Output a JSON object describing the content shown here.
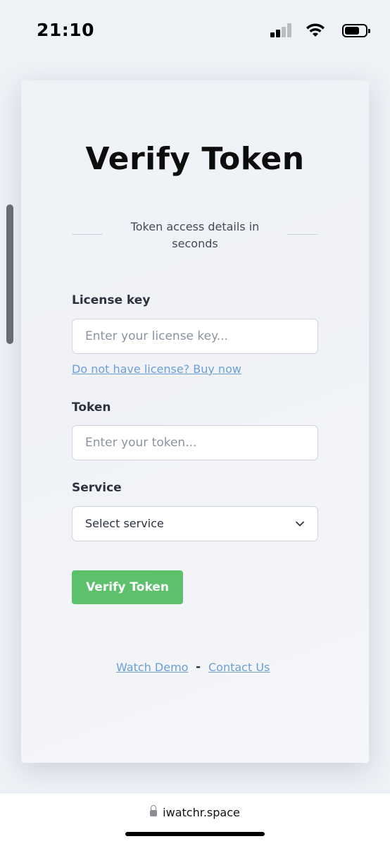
{
  "status_bar": {
    "time": "21:10",
    "battery_level": 0.7,
    "signal_bars_active": 2
  },
  "page": {
    "title": "Verify Token",
    "subtitle": "Token access details in seconds"
  },
  "form": {
    "license": {
      "label": "License key",
      "placeholder": "Enter your license key...",
      "value": "",
      "buy_link": "Do not have license? Buy now"
    },
    "token": {
      "label": "Token",
      "placeholder": "Enter your token...",
      "value": ""
    },
    "service": {
      "label": "Service",
      "selected": "Select service"
    },
    "submit_label": "Verify Token"
  },
  "footer": {
    "demo_link": "Watch Demo",
    "separator": "-",
    "contact_link": "Contact Us"
  },
  "browser": {
    "url": "iwatchr.space"
  },
  "colors": {
    "accent": "#5cc16a",
    "link": "#6b9fd6",
    "background": "#eef1f6"
  }
}
